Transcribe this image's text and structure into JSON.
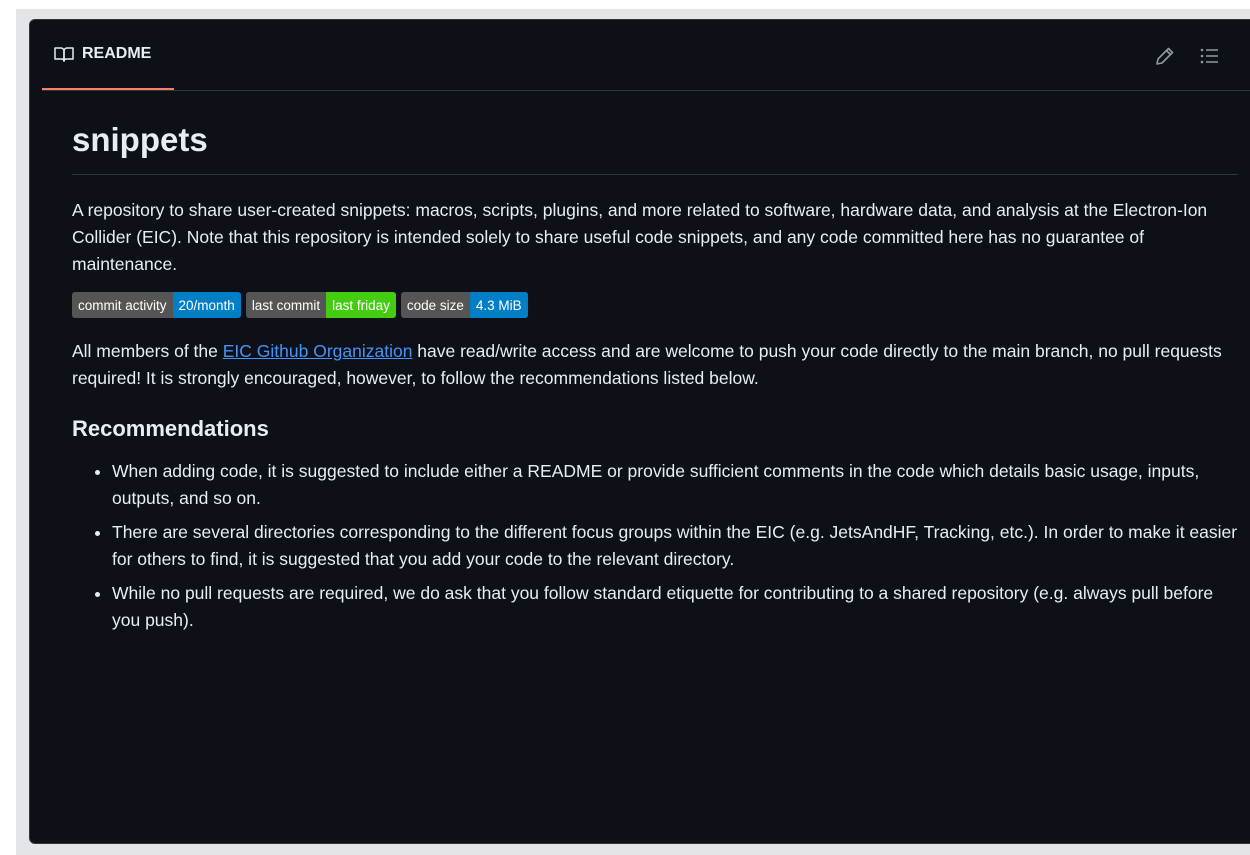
{
  "readme": {
    "tab_label": "README",
    "icons": {
      "tab": "book-icon",
      "edit": "pencil-icon",
      "toc": "list-icon"
    },
    "title": "snippets",
    "intro": "A repository to share user-created snippets: macros, scripts, plugins, and more related to software, hardware data, and analysis at the Electron-Ion Collider (EIC). Note that this repository is intended solely to share useful code snippets, and any code committed here has no guarantee of maintenance.",
    "badges": [
      {
        "label": "commit activity",
        "value": "20/month",
        "color": "#007ec6"
      },
      {
        "label": "last commit",
        "value": "last friday",
        "color": "#44cc11"
      },
      {
        "label": "code size",
        "value": "4.3 MiB",
        "color": "#007ec6"
      }
    ],
    "access": {
      "before": "All members of the ",
      "link_text": "EIC Github Organization",
      "after": " have read/write access and are welcome to push your code directly to the main branch, no pull requests required! It is strongly encouraged, however, to follow the recommendations listed below."
    },
    "recommendations_heading": "Recommendations",
    "recommendations": [
      "When adding code, it is suggested to include either a README or provide sufficient comments in the code which details basic usage, inputs, outputs, and so on.",
      "There are several directories corresponding to the different focus groups within the EIC (e.g. JetsAndHF, Tracking, etc.). In order to make it easier for others to find, it is suggested that you add your code to the relevant directory.",
      "While no pull requests are required, we do ask that you follow standard etiquette for contributing to a shared repository (e.g. always pull before you push)."
    ]
  },
  "colors": {
    "background": "#0d1117",
    "border": "#30363d",
    "text": "#e6edf3",
    "link": "#4493f8",
    "tab_underline": "#f78166"
  }
}
